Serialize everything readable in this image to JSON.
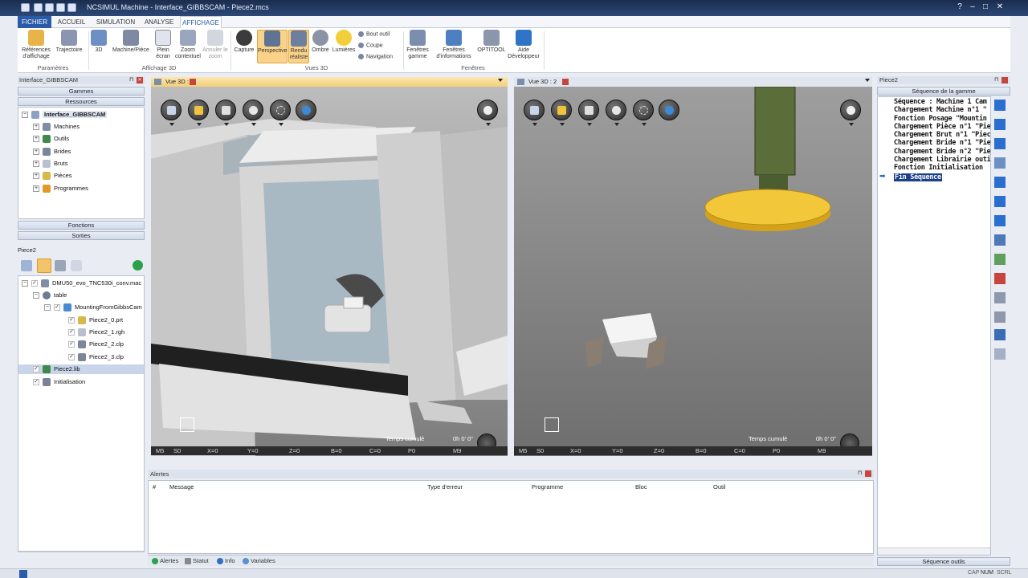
{
  "window": {
    "title": "NCSIMUL Machine - Interface_GIBBSCAM - Piece2.mcs"
  },
  "ribbon": {
    "tabs": [
      "FICHIER",
      "ACCUEIL",
      "SIMULATION",
      "ANALYSE",
      "AFFICHAGE"
    ],
    "buttons": {
      "references": "Références d'affichage",
      "trajectoire": "Trajectoire",
      "b3d": "3D",
      "machine_piece": "Machine/Pièce",
      "plein": "Plein écran",
      "zoom_ctx": "Zoom contextuel",
      "annuler_zoom": "Annuler le zoom",
      "capture": "Capture",
      "perspective": "Perspective",
      "rendu": "Rendu réaliste",
      "ombre": "Ombre",
      "lumieres": "Lumières",
      "bout_outil": "Bout outil",
      "coupe": "Coupe",
      "navigation": "Navigation",
      "fen_gamme": "Fenêtres gamme",
      "fen_info": "Fenêtres d'informations",
      "optitool": "OPTITOOL",
      "aide": "Aide Développeur"
    },
    "groups": {
      "parametres": "Paramètres",
      "affichage3d": "Affichage 3D",
      "vues3d": "Vues 3D",
      "fenetres": "Fenêtres"
    }
  },
  "left": {
    "header": "Interface_GIBBSCAM",
    "gammes": "Gammes",
    "ressources": "Ressources",
    "root": "Interface_GIBBSCAM",
    "resources": [
      "Machines",
      "Outils",
      "Brides",
      "Bruts",
      "Pièces",
      "Programmes"
    ],
    "fonctions": "Fonctions",
    "sorties": "Sorties",
    "piece_label": "Piece2",
    "tree": {
      "machine": "DMU50_evo_TNC530i_conv.mac",
      "table": "table",
      "mounting": "MountingFromGibbsCam",
      "files": [
        "Piece2_0.prt",
        "Piece2_1.rgh",
        "Piece2_2.clp",
        "Piece2_3.clp"
      ],
      "lib": "Piece2.lib",
      "init": "Initialisation"
    }
  },
  "views": [
    {
      "tab": "Vue 3D : 1",
      "temps_label": "Temps cumulé",
      "temps": "0h 0' 0\"",
      "status": [
        "M5",
        "S0",
        "X=0",
        "Y=0",
        "Z=0",
        "B=0",
        "C=0",
        "P0",
        "M9"
      ]
    },
    {
      "tab": "Vue 3D : 2",
      "temps_label": "Temps cumulé",
      "temps": "0h 0' 0\"",
      "status": [
        "M5",
        "S0",
        "X=0",
        "Y=0",
        "Z=0",
        "B=0",
        "C=0",
        "P0",
        "M9"
      ]
    }
  ],
  "alerts": {
    "title": "Alertes",
    "columns": [
      "#",
      "Message",
      "Type d'erreur",
      "Programme",
      "Bloc",
      "Outil"
    ],
    "tabs": [
      "Alertes",
      "Statut",
      "Info",
      "Variables"
    ]
  },
  "right": {
    "header": "Piece2",
    "seq_title": "Séquence de la gamme",
    "lines": [
      "Séquence : Machine 1 Cam",
      "Chargement Machine n°1 \"",
      "Fonction Posage \"Mountin",
      "Chargement Pièce n°1 \"Pie",
      "Chargement Brut n°1 \"Piec",
      "Chargement Bride n°1 \"Pie",
      "Chargement Bride n°2 \"Pie",
      "Chargement Librairie outil",
      "Fonction Initialisation",
      "Fin Séquence"
    ],
    "outils": "Séquence outils"
  },
  "statusbar": {
    "caps": "CAP",
    "num": "NUM",
    "scrl": "SCRL"
  }
}
